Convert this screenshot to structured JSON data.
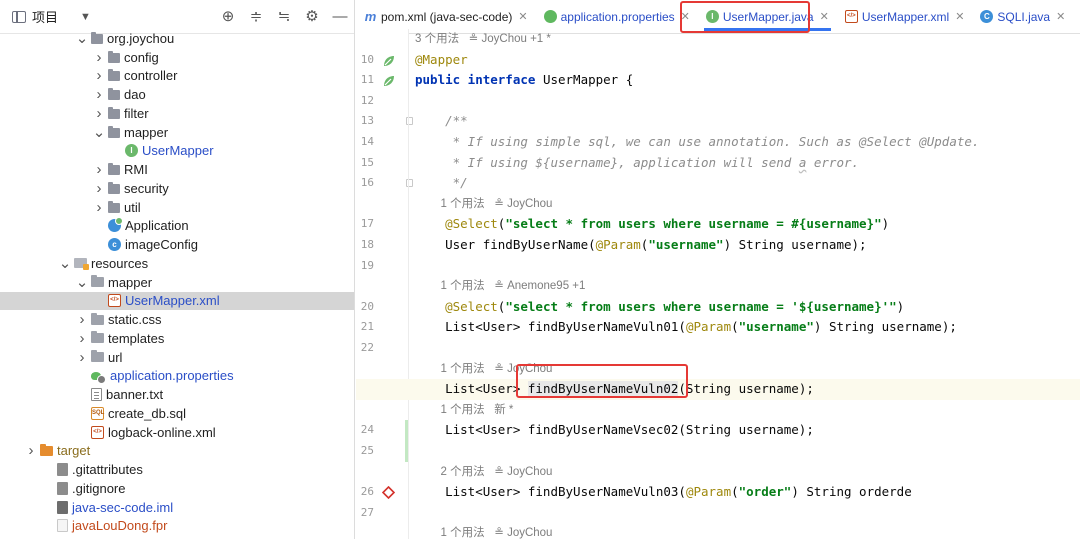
{
  "project": {
    "title": "项目",
    "tree": [
      {
        "indent": 3,
        "arrow": "▾",
        "icon": "pkg",
        "label": "org.joychou",
        "color": ""
      },
      {
        "indent": 4,
        "arrow": "›",
        "icon": "pkg",
        "label": "config",
        "color": ""
      },
      {
        "indent": 4,
        "arrow": "›",
        "icon": "pkg",
        "label": "controller",
        "color": ""
      },
      {
        "indent": 4,
        "arrow": "›",
        "icon": "pkg",
        "label": "dao",
        "color": ""
      },
      {
        "indent": 4,
        "arrow": "›",
        "icon": "pkg",
        "label": "filter",
        "color": ""
      },
      {
        "indent": 4,
        "arrow": "▾",
        "icon": "pkg",
        "label": "mapper",
        "color": ""
      },
      {
        "indent": 5,
        "arrow": "",
        "icon": "iface",
        "label": "UserMapper",
        "color": "blue"
      },
      {
        "indent": 4,
        "arrow": "›",
        "icon": "pkg",
        "label": "RMI",
        "color": ""
      },
      {
        "indent": 4,
        "arrow": "›",
        "icon": "pkg",
        "label": "security",
        "color": ""
      },
      {
        "indent": 4,
        "arrow": "›",
        "icon": "pkg",
        "label": "util",
        "color": ""
      },
      {
        "indent": 4,
        "arrow": "",
        "icon": "appcls",
        "label": "Application",
        "color": ""
      },
      {
        "indent": 4,
        "arrow": "",
        "icon": "cls",
        "label": "imageConfig",
        "color": ""
      },
      {
        "indent": 2,
        "arrow": "▾",
        "icon": "res",
        "label": "resources",
        "color": ""
      },
      {
        "indent": 3,
        "arrow": "▾",
        "icon": "folder",
        "label": "mapper",
        "color": ""
      },
      {
        "indent": 4,
        "arrow": "",
        "icon": "xml",
        "label": "UserMapper.xml",
        "color": "blue",
        "selected": true
      },
      {
        "indent": 3,
        "arrow": "›",
        "icon": "folder",
        "label": "static.css",
        "color": ""
      },
      {
        "indent": 3,
        "arrow": "›",
        "icon": "folder",
        "label": "templates",
        "color": ""
      },
      {
        "indent": 3,
        "arrow": "›",
        "icon": "folder",
        "label": "url",
        "color": ""
      },
      {
        "indent": 3,
        "arrow": "",
        "icon": "props",
        "label": "application.properties",
        "color": "blue"
      },
      {
        "indent": 3,
        "arrow": "",
        "icon": "txt",
        "label": "banner.txt",
        "color": ""
      },
      {
        "indent": 3,
        "arrow": "",
        "icon": "sql",
        "label": "create_db.sql",
        "color": ""
      },
      {
        "indent": 3,
        "arrow": "",
        "icon": "xml",
        "label": "logback-online.xml",
        "color": ""
      },
      {
        "indent": 0,
        "arrow": "›",
        "icon": "excluded",
        "label": "target",
        "color": "olive"
      },
      {
        "indent": 1,
        "arrow": "",
        "icon": "gitfile",
        "label": ".gitattributes",
        "color": ""
      },
      {
        "indent": 1,
        "arrow": "",
        "icon": "gitfile",
        "label": ".gitignore",
        "color": ""
      },
      {
        "indent": 1,
        "arrow": "",
        "icon": "iml",
        "label": "java-sec-code.iml",
        "color": "blue"
      },
      {
        "indent": 1,
        "arrow": "",
        "icon": "file",
        "label": "javaLouDong.fpr",
        "color": "red"
      }
    ]
  },
  "tabs": [
    {
      "icon": "m",
      "label": "pom.xml (java-sec-code)",
      "cls": "pom",
      "active": false
    },
    {
      "icon": "props",
      "label": "application.properties",
      "cls": "props",
      "active": false
    },
    {
      "icon": "i",
      "label": "UserMapper.java",
      "cls": "um",
      "active": true
    },
    {
      "icon": "xml",
      "label": "UserMapper.xml",
      "cls": "xml",
      "active": false
    },
    {
      "icon": "c",
      "label": "SQLI.java",
      "cls": "sqli",
      "active": false
    }
  ],
  "editor": {
    "rows": [
      {
        "kind": "hint",
        "num": "",
        "text": "3 个用法   ≗ JoyChou +1 *"
      },
      {
        "kind": "code",
        "num": "10",
        "gicon": "bean",
        "html": [
          [
            "ann",
            "@Mapper"
          ]
        ]
      },
      {
        "kind": "code",
        "num": "11",
        "gicon": "bean2",
        "html": [
          [
            "kw",
            "public interface "
          ],
          [
            "",
            "UserMapper {"
          ]
        ]
      },
      {
        "kind": "code",
        "num": "12",
        "html": []
      },
      {
        "kind": "code",
        "num": "13",
        "fold": true,
        "html": [
          [
            "cmt",
            "    /**"
          ]
        ]
      },
      {
        "kind": "code",
        "num": "14",
        "html": [
          [
            "cmt",
            "     * If using simple sql, we can use annotation. Such as @Select @Update."
          ]
        ]
      },
      {
        "kind": "code",
        "num": "15",
        "html": [
          [
            "cmt",
            "     * If using ${username}, application will send "
          ],
          [
            "cmt typo",
            "a"
          ],
          [
            "cmt",
            " error."
          ]
        ]
      },
      {
        "kind": "code",
        "num": "16",
        "fold": true,
        "html": [
          [
            "cmt",
            "     */"
          ]
        ]
      },
      {
        "kind": "hint",
        "num": "",
        "text": "        1 个用法   ≗ JoyChou"
      },
      {
        "kind": "code",
        "num": "17",
        "html": [
          [
            "ann",
            "    @Select"
          ],
          [
            "",
            "("
          ],
          [
            "str",
            "\"select * from users where username = #{username}\""
          ],
          [
            "",
            ")"
          ]
        ]
      },
      {
        "kind": "code",
        "num": "18",
        "html": [
          [
            "",
            "    User findByUserName("
          ],
          [
            "ann",
            "@Param"
          ],
          [
            "",
            "("
          ],
          [
            "str",
            "\"username\""
          ],
          [
            "",
            ") String username);"
          ]
        ]
      },
      {
        "kind": "code",
        "num": "19",
        "html": []
      },
      {
        "kind": "hint",
        "num": "",
        "text": "        1 个用法   ≗ Anemone95 +1"
      },
      {
        "kind": "code",
        "num": "20",
        "html": [
          [
            "ann",
            "    @Select"
          ],
          [
            "",
            "("
          ],
          [
            "str",
            "\"select * from users where username = '${username}'\""
          ],
          [
            "",
            ")"
          ]
        ]
      },
      {
        "kind": "code",
        "num": "21",
        "html": [
          [
            "",
            "    List<User> findByUserNameVuln01("
          ],
          [
            "ann",
            "@Param"
          ],
          [
            "",
            "("
          ],
          [
            "str",
            "\"username\""
          ],
          [
            "",
            ") String username);"
          ]
        ]
      },
      {
        "kind": "code",
        "num": "22",
        "html": []
      },
      {
        "kind": "hint",
        "num": "",
        "text": "        1 个用法   ≗ JoyChou"
      },
      {
        "kind": "code",
        "num": "23",
        "gicon": "diamond",
        "current": true,
        "html": [
          [
            "",
            "    List<User> "
          ],
          [
            "selword",
            "findByUserNameVuln02"
          ],
          [
            "",
            "(String username);"
          ]
        ]
      },
      {
        "kind": "hint",
        "num": "",
        "text": "        1 个用法   新 *"
      },
      {
        "kind": "code",
        "num": "24",
        "mod": true,
        "html": [
          [
            "",
            "    List<User> findByUserNameVsec02(String username);"
          ]
        ]
      },
      {
        "kind": "code",
        "num": "25",
        "mod": true,
        "html": []
      },
      {
        "kind": "hint",
        "num": "",
        "text": "        2 个用法   ≗ JoyChou"
      },
      {
        "kind": "code",
        "num": "26",
        "gicon": "diamond",
        "html": [
          [
            "",
            "    List<User> findByUserNameVuln03("
          ],
          [
            "ann",
            "@Param"
          ],
          [
            "",
            "("
          ],
          [
            "str",
            "\"order\""
          ],
          [
            "",
            ") String orderde"
          ]
        ]
      },
      {
        "kind": "code",
        "num": "27",
        "html": []
      },
      {
        "kind": "hint",
        "num": "",
        "text": "        1 个用法   ≗ JoyChou"
      }
    ]
  },
  "colors": {
    "accent": "#3574f0",
    "highlight_box": "#e53935",
    "current_line": "#fcfaed"
  }
}
